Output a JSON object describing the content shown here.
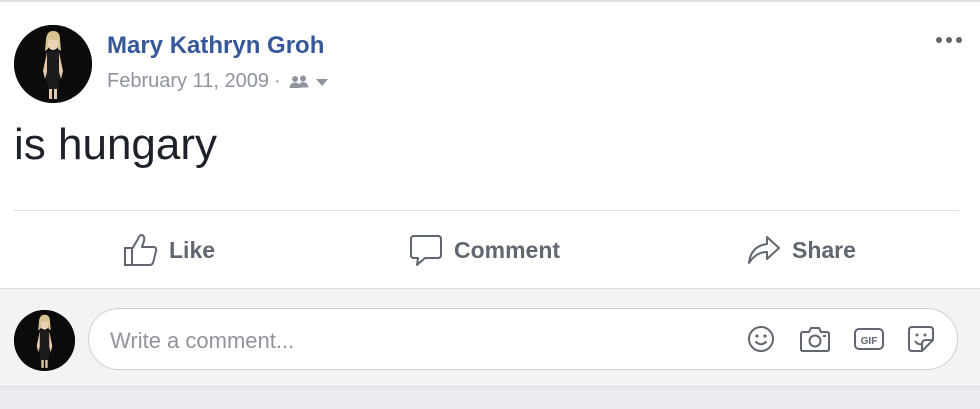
{
  "post": {
    "author": "Mary Kathryn Groh",
    "date": "February 11, 2009",
    "separator": "·",
    "audience_icon": "friends-icon",
    "dropdown_icon": "caret-down-icon",
    "more_icon": "ellipsis-icon",
    "text": "is hungary"
  },
  "actions": {
    "like": {
      "label": "Like",
      "icon": "thumbs-up-icon"
    },
    "comment": {
      "label": "Comment",
      "icon": "speech-bubble-icon"
    },
    "share": {
      "label": "Share",
      "icon": "share-arrow-icon"
    }
  },
  "comment_box": {
    "placeholder": "Write a comment...",
    "icons": [
      "emoji-icon",
      "camera-icon",
      "gif-icon",
      "sticker-icon"
    ]
  },
  "colors": {
    "author_link": "#365899",
    "meta_gray": "#8d949e",
    "action_gray": "#606770",
    "comment_bg": "#f2f3f5"
  }
}
